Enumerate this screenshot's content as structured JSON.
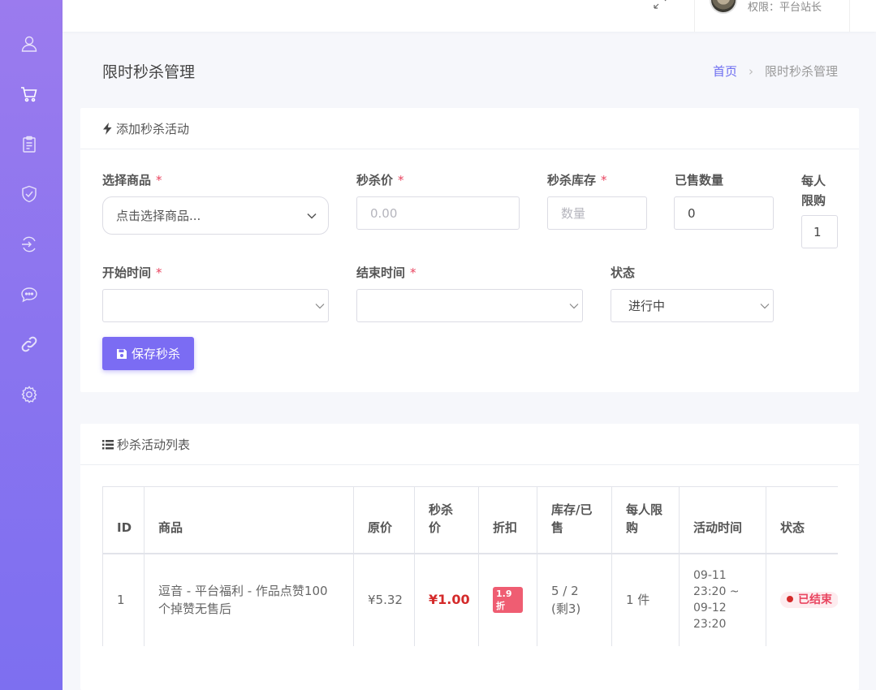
{
  "header": {
    "role_text": "权限：平台站长"
  },
  "page": {
    "title": "限时秒杀管理",
    "breadcrumb_home": "首页",
    "breadcrumb_sep": "›",
    "breadcrumb_current": "限时秒杀管理"
  },
  "form": {
    "card_title": "添加秒杀活动",
    "product_label": "选择商品",
    "product_placeholder": "点击选择商品...",
    "price_label": "秒杀价",
    "price_placeholder": "0.00",
    "stock_label": "秒杀库存",
    "stock_placeholder": "数量",
    "sold_label": "已售数量",
    "sold_value": "0",
    "limit_label_1": "每人",
    "limit_label_2": "限购",
    "limit_value": "1",
    "start_label": "开始时间",
    "end_label": "结束时间",
    "status_label": "状态",
    "status_value": "进行中",
    "required_mark": "*",
    "save_label": "保存秒杀"
  },
  "list": {
    "card_title": "秒杀活动列表",
    "columns": [
      "ID",
      "商品",
      "原价",
      "秒杀价",
      "折扣",
      "库存/已售",
      "每人限购",
      "活动时间",
      "状态"
    ],
    "rows": [
      {
        "id": "1",
        "product": "逗音 - 平台福利 - 作品点赞100个掉赞无售后",
        "orig_price": "¥5.32",
        "sale_price": "¥1.00",
        "discount": "1.9折",
        "stock_sold": "5 / 2 (剩3)",
        "limit": "1 件",
        "time": "09-11 23:20 ~ 09-12 23:20",
        "status": "已结束"
      }
    ]
  },
  "colors": {
    "accent": "#7b6cf3",
    "sidebar_top": "#9b7bee",
    "sidebar_bottom": "#7d6ff0",
    "required": "#e94560",
    "sale_price": "#d42a2a"
  },
  "sidebar": {
    "icons": [
      "user-icon",
      "cart-icon",
      "clipboard-icon",
      "shield-check-icon",
      "exchange-icon",
      "chat-icon",
      "link-icon",
      "gear-icon"
    ]
  }
}
